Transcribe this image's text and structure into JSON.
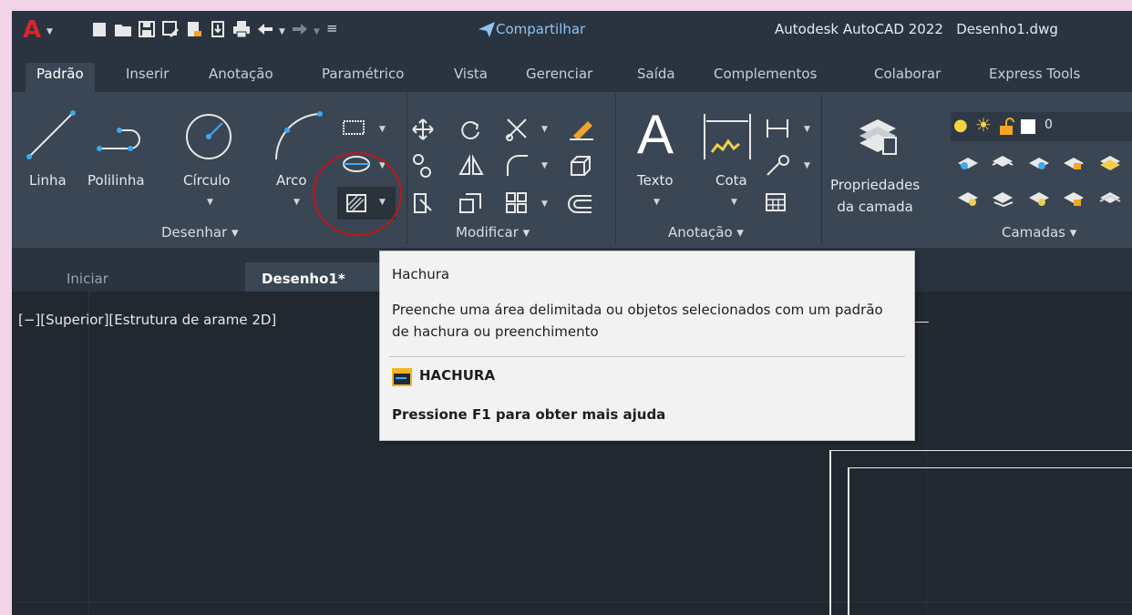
{
  "titlebar": {
    "app_menu": "A",
    "share": "Compartilhar",
    "app_name": "Autodesk AutoCAD 2022",
    "file_name": "Desenho1.dwg"
  },
  "tabs": [
    "Padrão",
    "Inserir",
    "Anotação",
    "Paramétrico",
    "Vista",
    "Gerenciar",
    "Saída",
    "Complementos",
    "Colaborar",
    "Express Tools"
  ],
  "ribbon": {
    "draw": {
      "line": "Linha",
      "polyline": "Polilinha",
      "circle": "Círculo",
      "arc": "Arco",
      "footer": "Desenhar"
    },
    "modify": {
      "footer": "Modificar"
    },
    "annotation": {
      "text": "Texto",
      "dimension": "Cota",
      "footer": "Anotação"
    },
    "layers": {
      "properties_line1": "Propriedades",
      "properties_line2": "da camada",
      "layer_name": "0",
      "footer": "Camadas"
    }
  },
  "doctabs": {
    "start": "Iniciar",
    "drawing": "Desenho1*"
  },
  "viewport": {
    "label": "[−][Superior][Estrutura de arame 2D]"
  },
  "tooltip": {
    "title": "Hachura",
    "description": "Preenche uma área delimitada ou objetos selecionados com um padrão de hachura ou preenchimento",
    "command": "HACHURA",
    "help": "Pressione F1 para obter mais ajuda"
  },
  "colors": {
    "annotation_circle": "#c2151a",
    "accent_share": "#8fc3f3",
    "app_logo": "#d6262b"
  }
}
